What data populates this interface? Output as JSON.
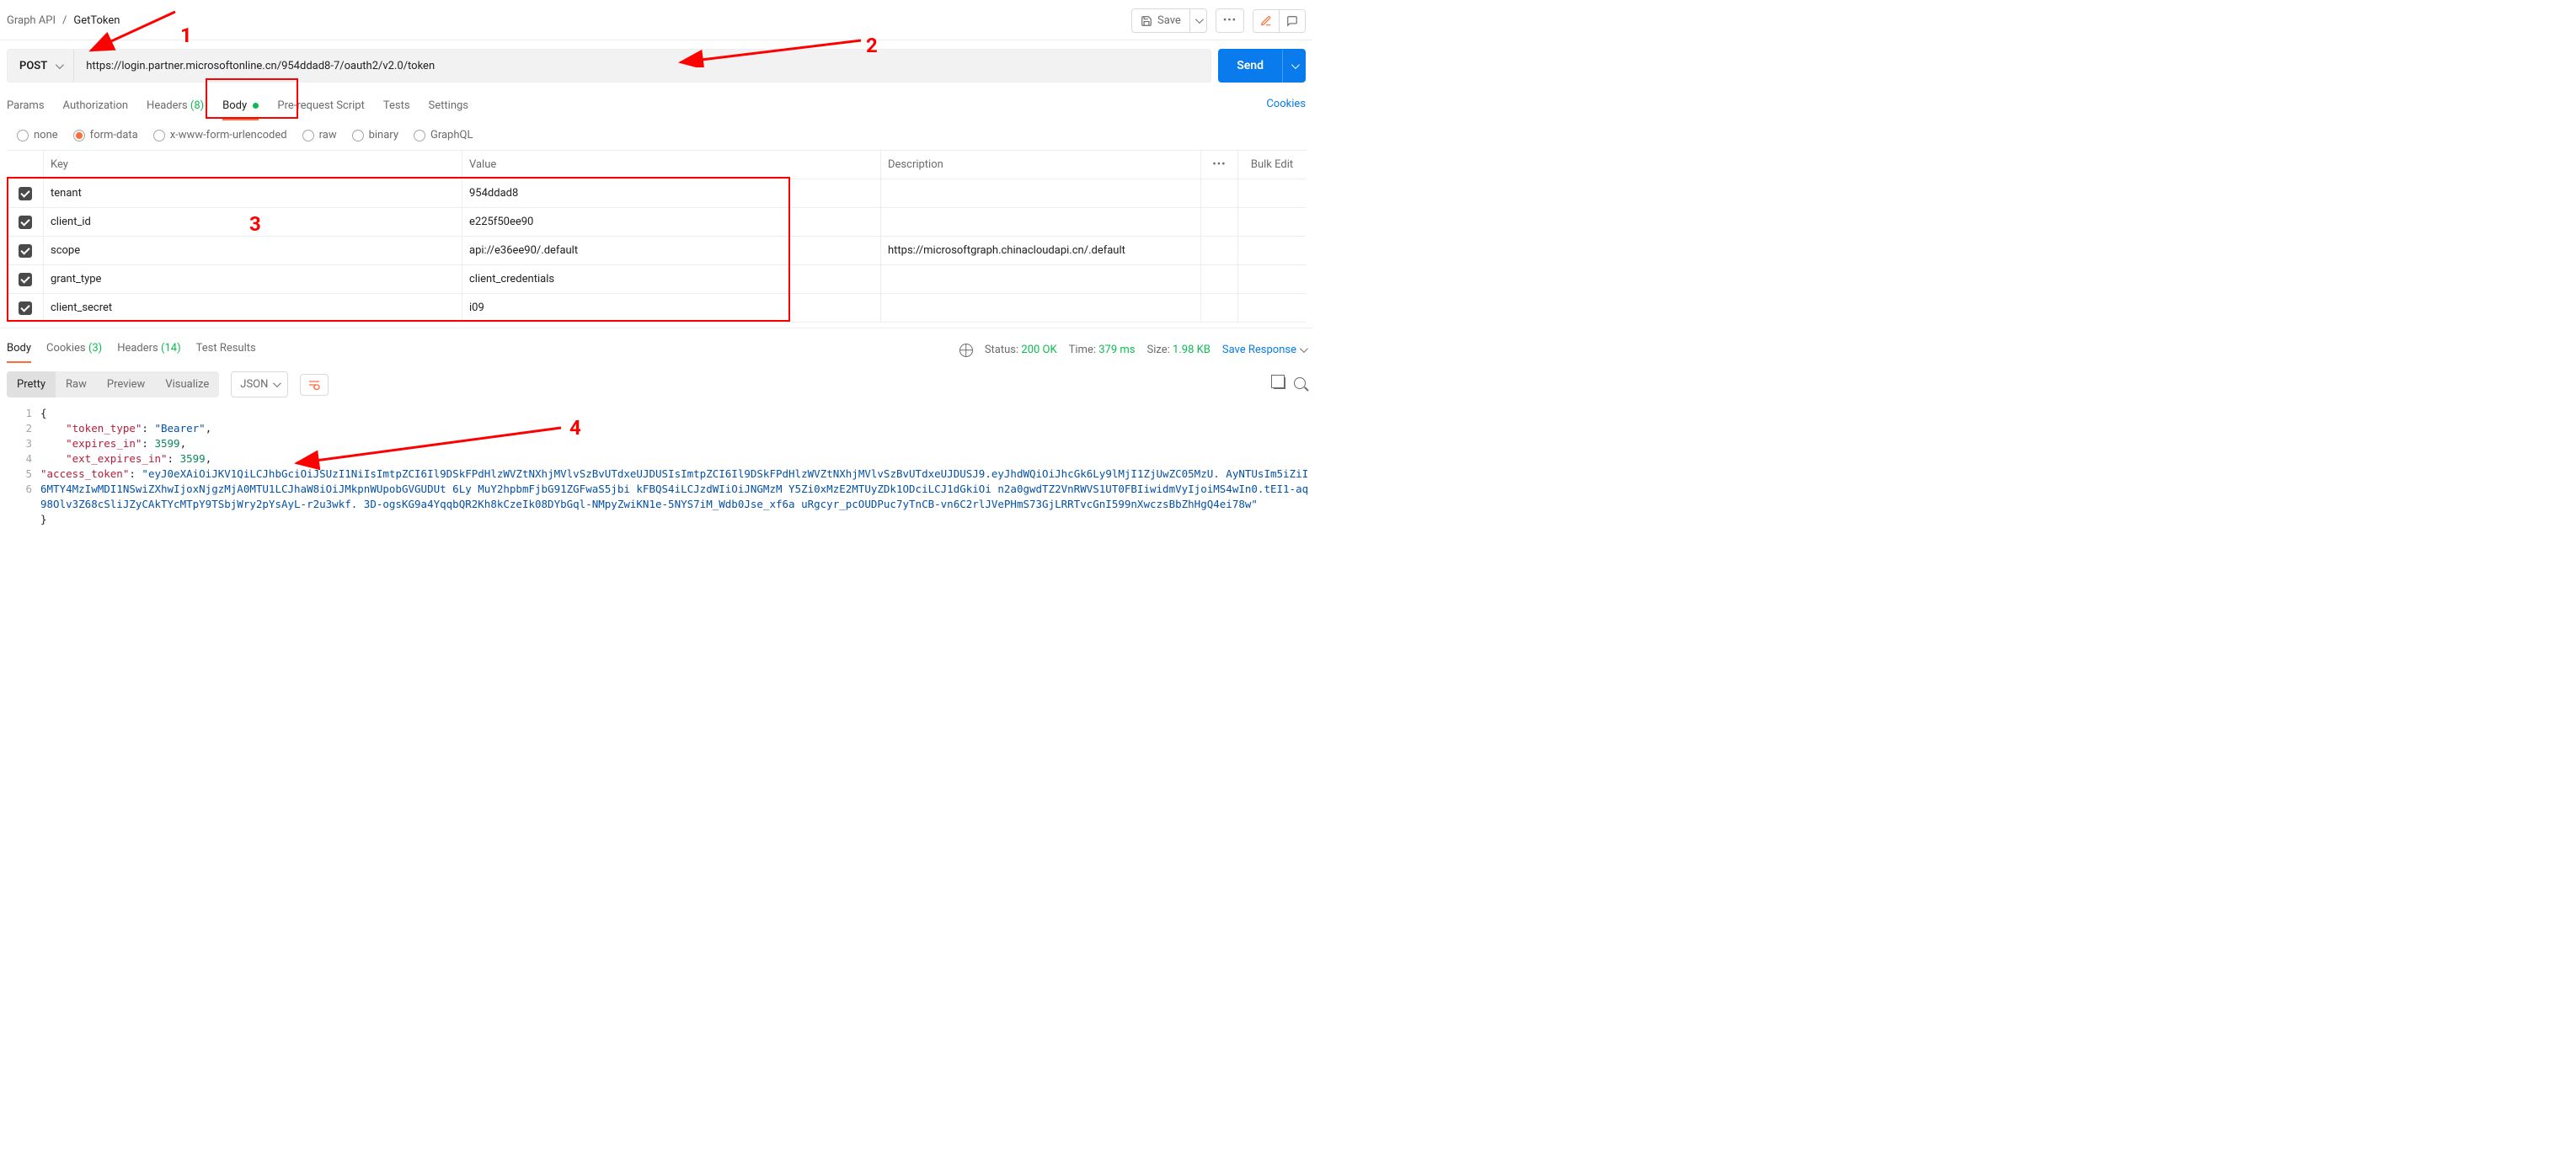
{
  "breadcrumb": {
    "folder": "Graph API",
    "request": "GetToken"
  },
  "topbar": {
    "save": "Save"
  },
  "request": {
    "method": "POST",
    "url": "https://login.partner.microsoftonline.cn/954ddad8-",
    "url_masked": "                                                  ",
    "url_tail": "7/oauth2/v2.0/token",
    "send": "Send"
  },
  "tabs": {
    "params": "Params",
    "authorization": "Authorization",
    "headers": "Headers",
    "headers_count": "(8)",
    "body": "Body",
    "prerequest": "Pre-request Script",
    "tests": "Tests",
    "settings": "Settings",
    "cookies": "Cookies"
  },
  "body_types": {
    "none": "none",
    "form_data": "form-data",
    "urlencoded": "x-www-form-urlencoded",
    "raw": "raw",
    "binary": "binary",
    "graphql": "GraphQL"
  },
  "table": {
    "headers": {
      "key": "Key",
      "value": "Value",
      "description": "Description",
      "bulk": "Bulk Edit"
    },
    "rows": [
      {
        "key": "tenant",
        "value_head": "954ddad8",
        "value_masked": "                              ",
        "description": ""
      },
      {
        "key": "client_id",
        "value_head": "e225f50",
        "value_masked": "                           ",
        "value_tail": "ee90",
        "description": ""
      },
      {
        "key": "scope",
        "value_head": "api://e",
        "value_masked": "                              ",
        "value_tail": "36ee90/.default",
        "description": "https://microsoftgraph.chinacloudapi.cn/.default"
      },
      {
        "key": "grant_type",
        "value_head": "client_credentials",
        "description": ""
      },
      {
        "key": "client_secret",
        "value_head": "i09",
        "value_masked": "                               ",
        "description": ""
      }
    ]
  },
  "response_tabs": {
    "body": "Body",
    "cookies": "Cookies",
    "cookies_count": "(3)",
    "headers": "Headers",
    "headers_count": "(14)",
    "tests": "Test Results"
  },
  "response_meta": {
    "status_label": "Status:",
    "status_value": "200 OK",
    "time_label": "Time:",
    "time_value": "379 ms",
    "size_label": "Size:",
    "size_value": "1.98 KB",
    "save_response": "Save Response"
  },
  "viewer": {
    "pretty": "Pretty",
    "raw": "Raw",
    "preview": "Preview",
    "visualize": "Visualize",
    "format": "JSON"
  },
  "json_response": {
    "lines": [
      "1",
      "2",
      "3",
      "4",
      "5",
      "6"
    ],
    "l1": "{",
    "l2_k": "\"token_type\"",
    "l2_v": "\"Bearer\"",
    "l3_k": "\"expires_in\"",
    "l3_v": "3599",
    "l4_k": "\"ext_expires_in\"",
    "l4_v": "3599",
    "l5_k": "\"access_token\"",
    "l5_v": "\"eyJ0eXAiOiJKV1QiLCJhbGciOiJSUzI1NiIsImtpZCI6Il9DSkFPdHlzWVZtNXhjMVlvSzBvUTdxeUJDUSIsImtpZCI6Il9DSkFPdHlzWVZtNXhjMVlvSzBvUTdxeUJDUSJ9.eyJhdWQiOiJhcGk6Ly9lMjI1ZjUwZC05MzU.                                                                                                                                                                                                                                                AyNTUsIm5iZiI6MTY4MzIwMDI1NSwiZXhwIjoxNjgzMjA0MTU1LCJhaW8iOiJMkpnWUpobGVGUDUt                                                                                                                                                                                                                                                6Ly      MuY2hpbmFjbG91ZGFwaS5jbi                                                                                                                                                                                                                                                                                                                            kFBQS4iLCJzdWIiOiJNGMzM                                                                                           Y5Zi0xMzE2MTUyZDk1ODciLCJ1dGkiOi                  n2a0gwdTZ2VnRWVS1UT0FBIiwidmVyIjoiMS4wIn0.tEI1-aq98Olv3Z68cSliJZyCAkTYcMTpY9TSbjWry2pYsAyL-r2u3wkf.                                                                                                                                                                                                                                   3D-ogsKG9a4YqqbQR2Kh8kCzeIk08DYbGql-NMpyZwiKN1e-5NYS7iM_Wdb0Jse_xf6a                            uRgcyr_pcOUDPuc7yTnCB-vn6C2rlJVePHmS73GjLRRTvcGnI599nXwczsBbZhHgQ4ei78w\"",
    "l6": "}"
  },
  "annotations": {
    "a1": "1",
    "a2": "2",
    "a3": "3",
    "a4": "4"
  }
}
